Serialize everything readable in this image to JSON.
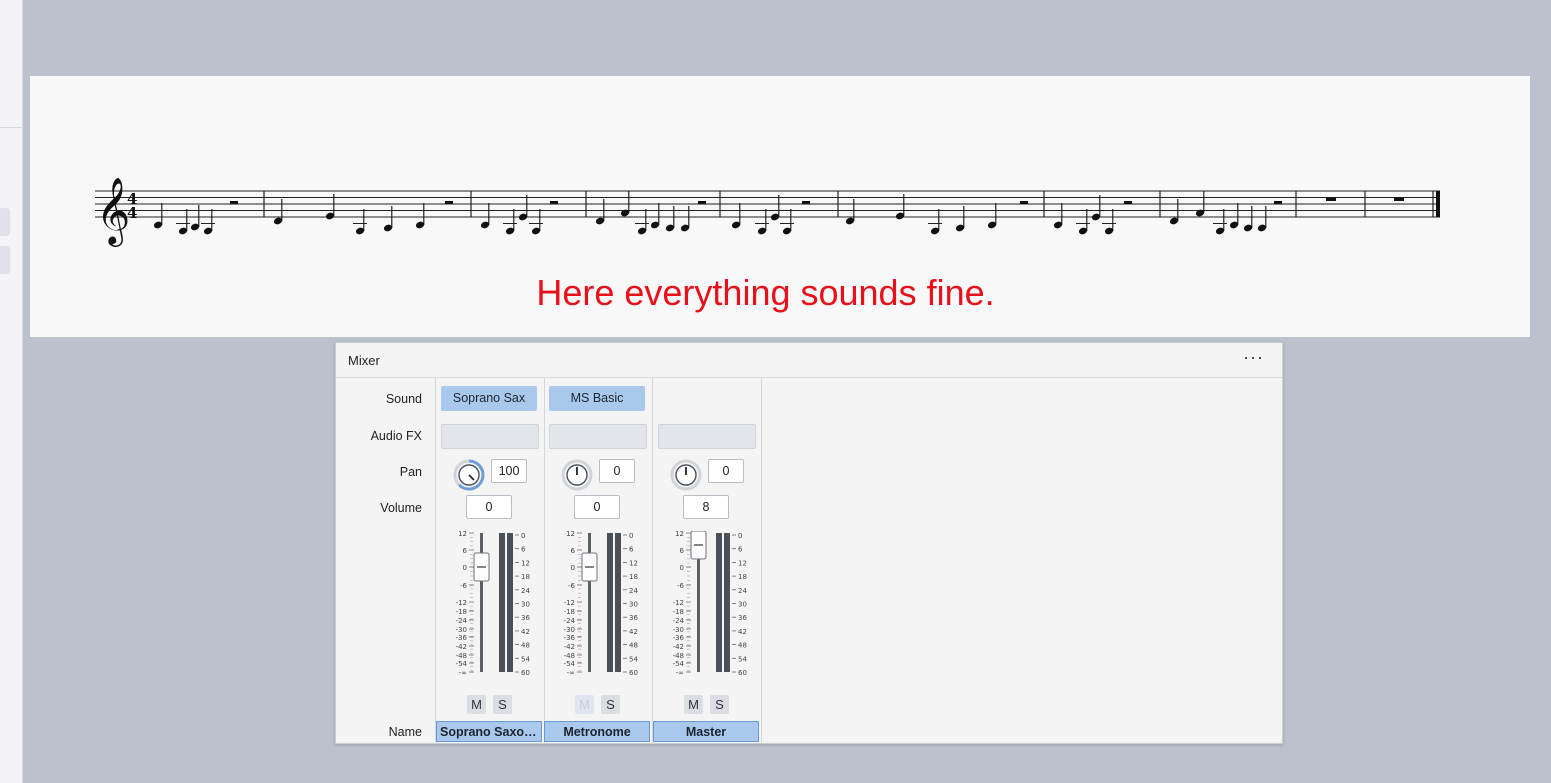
{
  "score": {
    "caption": "Here everything sounds fine.",
    "caption_color": "#e8101a",
    "time_signature": {
      "top": "4",
      "bottom": "4"
    }
  },
  "mixer": {
    "title": "Mixer",
    "menu_label": "···",
    "row_labels": {
      "sound": "Sound",
      "audio_fx": "Audio FX",
      "pan": "Pan",
      "volume": "Volume",
      "name": "Name"
    },
    "fader_scale": [
      "12",
      "6",
      "0",
      "-6",
      "-12",
      "-18",
      "-24",
      "-30",
      "-36",
      "-42",
      "-48",
      "-54",
      "-∞"
    ],
    "meter_scale": [
      "0",
      "6",
      "12",
      "18",
      "24",
      "30",
      "36",
      "42",
      "48",
      "54",
      "60"
    ],
    "mute_label": "M",
    "solo_label": "S",
    "channels": [
      {
        "sound": "Soprano Sax",
        "pan": "100",
        "volume": "0",
        "name": "Soprano Saxop...",
        "mute_enabled": true
      },
      {
        "sound": "MS Basic",
        "pan": "0",
        "volume": "0",
        "name": "Metronome",
        "mute_enabled": false
      },
      {
        "sound": "",
        "pan": "0",
        "volume": "8",
        "name": "Master",
        "mute_enabled": true
      }
    ],
    "accent_color": "#a8c9ec"
  }
}
